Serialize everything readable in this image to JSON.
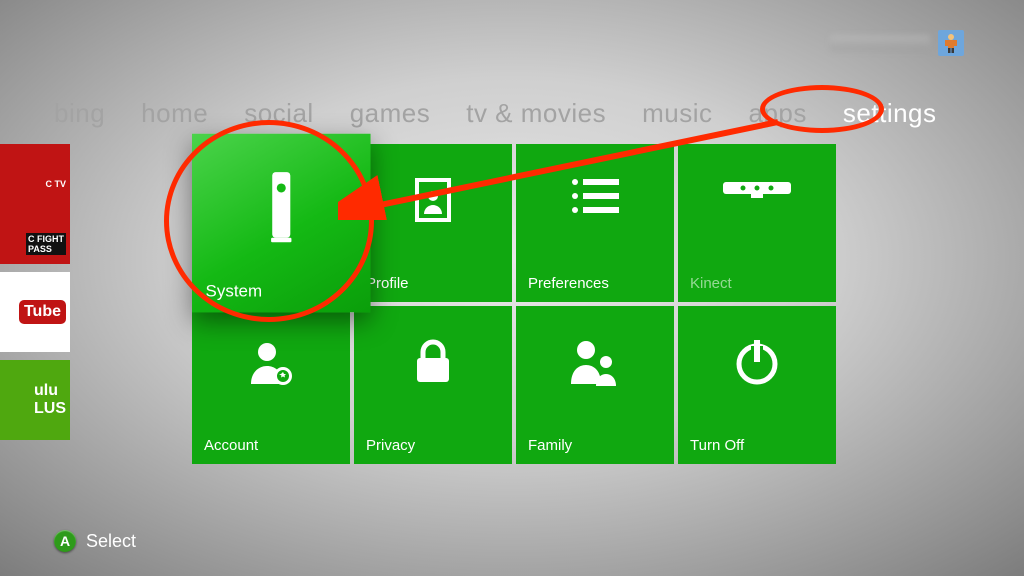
{
  "profile": {
    "gamertag": ""
  },
  "nav": {
    "items": [
      {
        "label": "bing"
      },
      {
        "label": "home"
      },
      {
        "label": "social"
      },
      {
        "label": "games"
      },
      {
        "label": "tv & movies"
      },
      {
        "label": "music"
      },
      {
        "label": "apps"
      },
      {
        "label": "settings"
      }
    ],
    "active_index": 7
  },
  "side": {
    "items": [
      {
        "label_line1": "C TV"
      },
      {
        "label_line1": "C FIGHT",
        "label_line2": "PASS"
      },
      {
        "label": "Tube"
      },
      {
        "label_line1": "ulu",
        "label_line2": "LUS"
      }
    ]
  },
  "tiles": [
    {
      "label": "System",
      "icon": "console-icon",
      "state": "focused"
    },
    {
      "label": "Profile",
      "icon": "profile-icon",
      "state": "normal"
    },
    {
      "label": "Preferences",
      "icon": "preferences-icon",
      "state": "normal"
    },
    {
      "label": "Kinect",
      "icon": "kinect-icon",
      "state": "disabled"
    },
    {
      "label": "Account",
      "icon": "account-icon",
      "state": "normal"
    },
    {
      "label": "Privacy",
      "icon": "privacy-icon",
      "state": "normal"
    },
    {
      "label": "Family",
      "icon": "family-icon",
      "state": "normal"
    },
    {
      "label": "Turn Off",
      "icon": "power-icon",
      "state": "normal"
    }
  ],
  "hint": {
    "button": "A",
    "label": "Select"
  },
  "colors": {
    "tile_green": "#10a810",
    "annotation": "#ff2a00"
  },
  "annotations": [
    {
      "type": "oval",
      "target": "nav-settings"
    },
    {
      "type": "oval",
      "target": "tile-system"
    },
    {
      "type": "arrow",
      "from": "nav-settings",
      "to": "tile-system"
    }
  ]
}
